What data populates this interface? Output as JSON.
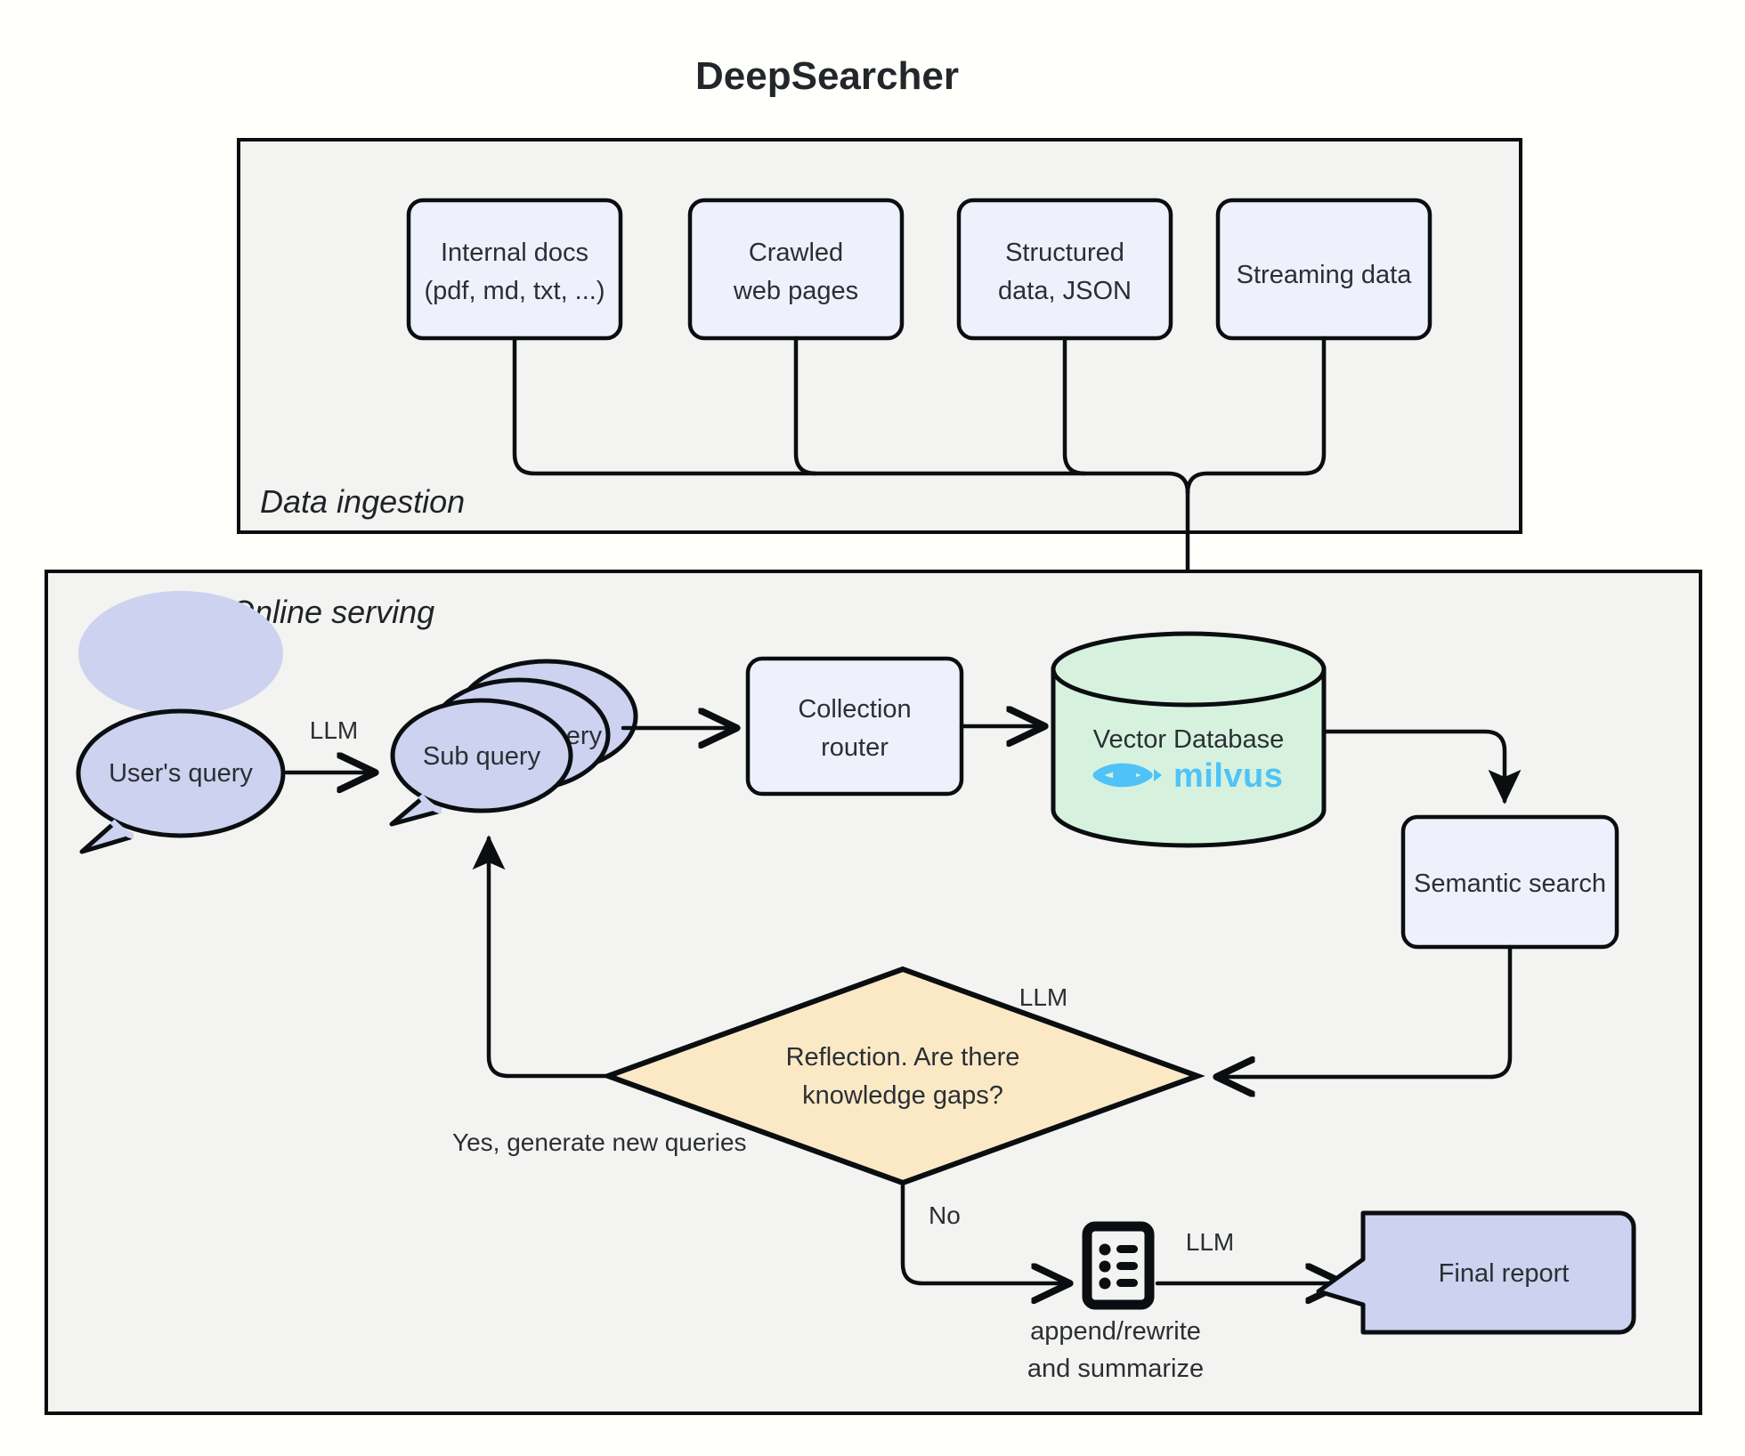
{
  "title": "DeepSearcher",
  "colors": {
    "page_background": "#fffffc",
    "group_fill": "#f3f3f1",
    "stroke": "#0b0e11",
    "box_fill": "#eef1fb",
    "bubble_fill": "#ccd2ef",
    "db_fill": "#d6f2df",
    "decision_fill": "#fbe9c6",
    "milvus_logo": "#4fc3f7",
    "text": "#2b2f33"
  },
  "groups": [
    {
      "id": "data-ingestion",
      "label": "Data ingestion"
    },
    {
      "id": "online-serving",
      "label": "Online serving"
    }
  ],
  "ingestion": {
    "sources": [
      {
        "id": "internal-docs",
        "lines": [
          "Internal docs",
          "(pdf, md, txt, ...)"
        ]
      },
      {
        "id": "crawled-web-pages",
        "lines": [
          "Crawled",
          "web pages"
        ]
      },
      {
        "id": "structured-data",
        "lines": [
          "Structured",
          "data, JSON"
        ]
      },
      {
        "id": "streaming-data",
        "lines": [
          "Streaming data"
        ]
      }
    ]
  },
  "serving": {
    "user_query": {
      "id": "users-query",
      "label": "User's query"
    },
    "sub_query": {
      "id": "sub-query",
      "label": "Sub query",
      "stack_count": 3
    },
    "collection_router": {
      "id": "collection-router",
      "lines": [
        "Collection",
        "router"
      ]
    },
    "vector_database": {
      "id": "vector-database",
      "label": "Vector Database",
      "logo_label": "milvus"
    },
    "semantic_search": {
      "id": "semantic-search",
      "label": "Semantic search"
    },
    "reflection": {
      "id": "reflection-decision",
      "lines": [
        "Reflection. Are there",
        "knowledge gaps?"
      ]
    },
    "summarize": {
      "id": "append-rewrite-summarize",
      "lines": [
        "append/rewrite",
        "and summarize"
      ]
    },
    "final_report": {
      "id": "final-report",
      "label": "Final report"
    }
  },
  "edge_labels": {
    "llm_user_to_sub": "LLM",
    "llm_reflection": "LLM",
    "llm_summarize_to_report": "LLM",
    "yes_branch": "Yes, generate new queries",
    "no_branch": "No"
  }
}
